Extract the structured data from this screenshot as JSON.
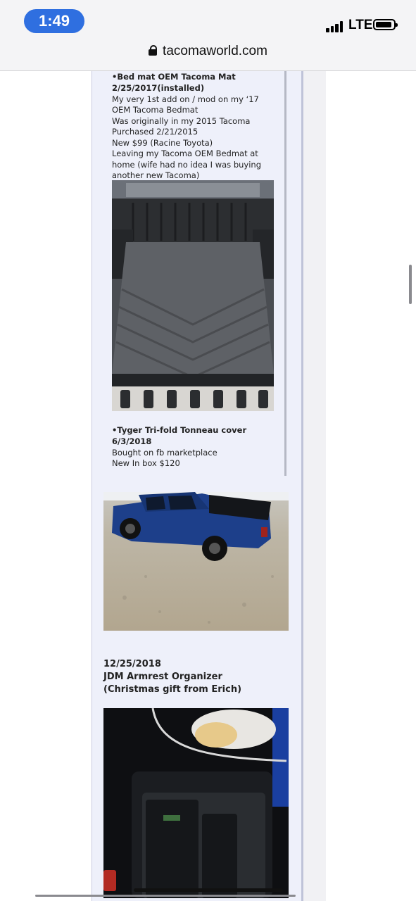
{
  "status_bar": {
    "time": "1:49",
    "network": "LTE",
    "icons": [
      "signal-icon",
      "battery-icon"
    ]
  },
  "url_bar": {
    "domain": "tacomaworld.com",
    "icon": "lock-icon"
  },
  "post": {
    "item1": {
      "title_line1": "•Bed mat OEM Tacoma Mat",
      "title_line2": "2/25/2017(installed)",
      "body": [
        "My very 1st add on / mod on my ‘17",
        "OEM Tacoma Bedmat",
        "Was originally in my 2015 Tacoma",
        "Purchased 2/21/2015",
        "New $99 (Racine Toyota)",
        "Leaving my Tacoma OEM Bedmat at",
        "home (wife had no idea I was buying",
        "another new Tacoma)"
      ]
    },
    "item2": {
      "title_line1": "•Tyger Tri-fold Tonneau cover",
      "title_line2": "6/3/2018",
      "body": [
        "Bought on fb marketplace",
        "New In box $120"
      ]
    },
    "item3": {
      "title_line1": "12/25/2018",
      "title_line2": "JDM Armrest Organizer",
      "title_line3": "(Christmas gift from Erich)"
    }
  }
}
